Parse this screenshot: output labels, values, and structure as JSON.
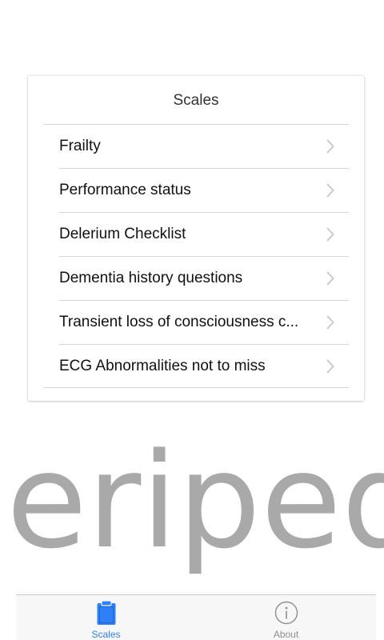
{
  "card": {
    "title": "Scales",
    "items": [
      {
        "label": "Frailty"
      },
      {
        "label": "Performance status"
      },
      {
        "label": "Delerium Checklist"
      },
      {
        "label": "Dementia history questions"
      },
      {
        "label": "Transient loss of consciousness c..."
      },
      {
        "label": "ECG Abnormalities not to miss"
      }
    ]
  },
  "logo_text": "eripedi",
  "tabbar": {
    "tabs": [
      {
        "label": "Scales",
        "icon": "clipboard-icon",
        "active": true
      },
      {
        "label": "About",
        "icon": "info-circle-icon",
        "active": false
      }
    ]
  },
  "colors": {
    "accent": "#2f7ff7",
    "inactive": "#8e8e93",
    "logo": "#a9a9a9",
    "divider": "#d6d6d6"
  }
}
